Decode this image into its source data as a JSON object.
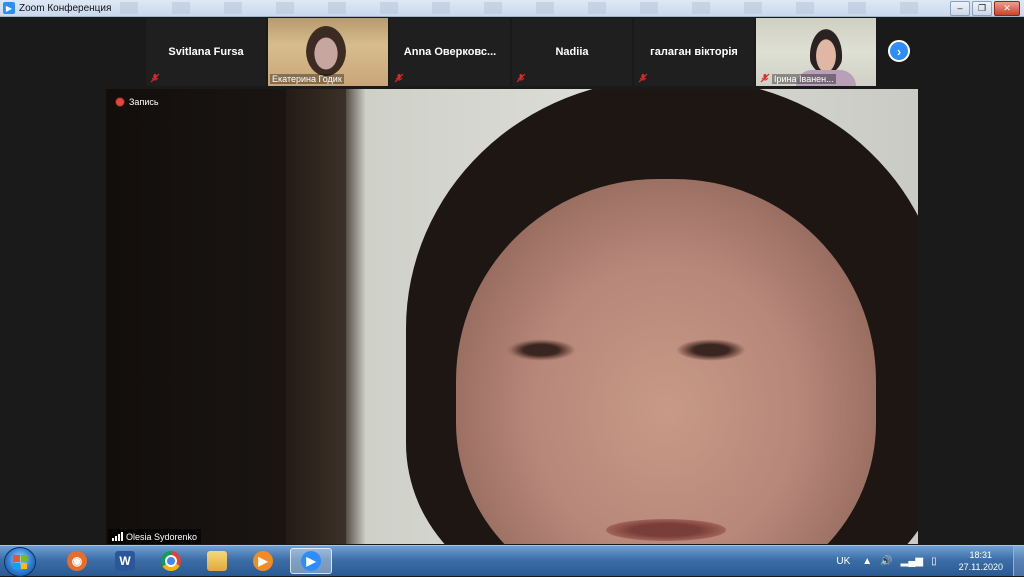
{
  "window": {
    "title": "Zoom Конференция"
  },
  "thumbnails": [
    {
      "name": "Svitlana Fursa",
      "video": false
    },
    {
      "name": "Екатерина Годик",
      "video": true
    },
    {
      "name": "Anna  Оверковс...",
      "video": false
    },
    {
      "name": "Nadiia",
      "video": false
    },
    {
      "name": "галаган вікторія",
      "video": false
    },
    {
      "name": "Ірина Іванен...",
      "video": true
    }
  ],
  "main": {
    "recording_label": "Запись",
    "speaker_name": "Olesia Sydorenko"
  },
  "taskbar": {
    "apps": [
      {
        "name": "eye-app"
      },
      {
        "name": "word",
        "label": "W"
      },
      {
        "name": "chrome"
      },
      {
        "name": "file-explorer"
      },
      {
        "name": "media-player"
      },
      {
        "name": "zoom",
        "active": true
      }
    ],
    "language": "UK",
    "time": "18:31",
    "date": "27.11.2020"
  },
  "colors": {
    "zoom_blue": "#2d8cff",
    "rec_red": "#e0463e",
    "muted_red": "#e0282a"
  }
}
